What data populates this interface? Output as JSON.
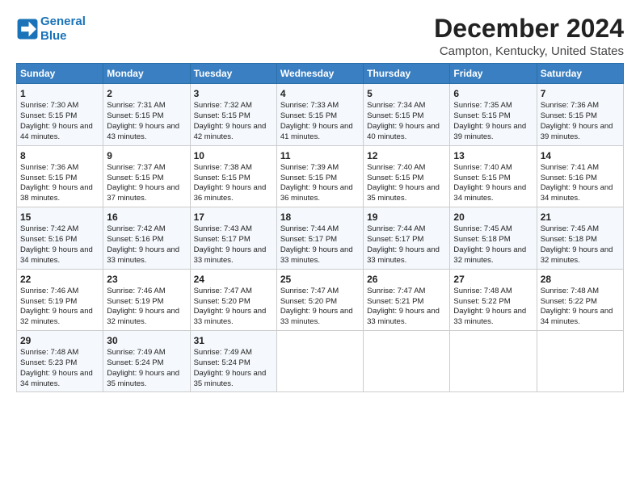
{
  "header": {
    "logo_line1": "General",
    "logo_line2": "Blue",
    "title": "December 2024",
    "subtitle": "Campton, Kentucky, United States"
  },
  "columns": [
    "Sunday",
    "Monday",
    "Tuesday",
    "Wednesday",
    "Thursday",
    "Friday",
    "Saturday"
  ],
  "weeks": [
    [
      {
        "day": "1",
        "info": "Sunrise: 7:30 AM\nSunset: 5:15 PM\nDaylight: 9 hours and 44 minutes."
      },
      {
        "day": "2",
        "info": "Sunrise: 7:31 AM\nSunset: 5:15 PM\nDaylight: 9 hours and 43 minutes."
      },
      {
        "day": "3",
        "info": "Sunrise: 7:32 AM\nSunset: 5:15 PM\nDaylight: 9 hours and 42 minutes."
      },
      {
        "day": "4",
        "info": "Sunrise: 7:33 AM\nSunset: 5:15 PM\nDaylight: 9 hours and 41 minutes."
      },
      {
        "day": "5",
        "info": "Sunrise: 7:34 AM\nSunset: 5:15 PM\nDaylight: 9 hours and 40 minutes."
      },
      {
        "day": "6",
        "info": "Sunrise: 7:35 AM\nSunset: 5:15 PM\nDaylight: 9 hours and 39 minutes."
      },
      {
        "day": "7",
        "info": "Sunrise: 7:36 AM\nSunset: 5:15 PM\nDaylight: 9 hours and 39 minutes."
      }
    ],
    [
      {
        "day": "8",
        "info": "Sunrise: 7:36 AM\nSunset: 5:15 PM\nDaylight: 9 hours and 38 minutes."
      },
      {
        "day": "9",
        "info": "Sunrise: 7:37 AM\nSunset: 5:15 PM\nDaylight: 9 hours and 37 minutes."
      },
      {
        "day": "10",
        "info": "Sunrise: 7:38 AM\nSunset: 5:15 PM\nDaylight: 9 hours and 36 minutes."
      },
      {
        "day": "11",
        "info": "Sunrise: 7:39 AM\nSunset: 5:15 PM\nDaylight: 9 hours and 36 minutes."
      },
      {
        "day": "12",
        "info": "Sunrise: 7:40 AM\nSunset: 5:15 PM\nDaylight: 9 hours and 35 minutes."
      },
      {
        "day": "13",
        "info": "Sunrise: 7:40 AM\nSunset: 5:15 PM\nDaylight: 9 hours and 34 minutes."
      },
      {
        "day": "14",
        "info": "Sunrise: 7:41 AM\nSunset: 5:16 PM\nDaylight: 9 hours and 34 minutes."
      }
    ],
    [
      {
        "day": "15",
        "info": "Sunrise: 7:42 AM\nSunset: 5:16 PM\nDaylight: 9 hours and 34 minutes."
      },
      {
        "day": "16",
        "info": "Sunrise: 7:42 AM\nSunset: 5:16 PM\nDaylight: 9 hours and 33 minutes."
      },
      {
        "day": "17",
        "info": "Sunrise: 7:43 AM\nSunset: 5:17 PM\nDaylight: 9 hours and 33 minutes."
      },
      {
        "day": "18",
        "info": "Sunrise: 7:44 AM\nSunset: 5:17 PM\nDaylight: 9 hours and 33 minutes."
      },
      {
        "day": "19",
        "info": "Sunrise: 7:44 AM\nSunset: 5:17 PM\nDaylight: 9 hours and 33 minutes."
      },
      {
        "day": "20",
        "info": "Sunrise: 7:45 AM\nSunset: 5:18 PM\nDaylight: 9 hours and 32 minutes."
      },
      {
        "day": "21",
        "info": "Sunrise: 7:45 AM\nSunset: 5:18 PM\nDaylight: 9 hours and 32 minutes."
      }
    ],
    [
      {
        "day": "22",
        "info": "Sunrise: 7:46 AM\nSunset: 5:19 PM\nDaylight: 9 hours and 32 minutes."
      },
      {
        "day": "23",
        "info": "Sunrise: 7:46 AM\nSunset: 5:19 PM\nDaylight: 9 hours and 32 minutes."
      },
      {
        "day": "24",
        "info": "Sunrise: 7:47 AM\nSunset: 5:20 PM\nDaylight: 9 hours and 33 minutes."
      },
      {
        "day": "25",
        "info": "Sunrise: 7:47 AM\nSunset: 5:20 PM\nDaylight: 9 hours and 33 minutes."
      },
      {
        "day": "26",
        "info": "Sunrise: 7:47 AM\nSunset: 5:21 PM\nDaylight: 9 hours and 33 minutes."
      },
      {
        "day": "27",
        "info": "Sunrise: 7:48 AM\nSunset: 5:22 PM\nDaylight: 9 hours and 33 minutes."
      },
      {
        "day": "28",
        "info": "Sunrise: 7:48 AM\nSunset: 5:22 PM\nDaylight: 9 hours and 34 minutes."
      }
    ],
    [
      {
        "day": "29",
        "info": "Sunrise: 7:48 AM\nSunset: 5:23 PM\nDaylight: 9 hours and 34 minutes."
      },
      {
        "day": "30",
        "info": "Sunrise: 7:49 AM\nSunset: 5:24 PM\nDaylight: 9 hours and 35 minutes."
      },
      {
        "day": "31",
        "info": "Sunrise: 7:49 AM\nSunset: 5:24 PM\nDaylight: 9 hours and 35 minutes."
      },
      {
        "day": "",
        "info": ""
      },
      {
        "day": "",
        "info": ""
      },
      {
        "day": "",
        "info": ""
      },
      {
        "day": "",
        "info": ""
      }
    ]
  ]
}
